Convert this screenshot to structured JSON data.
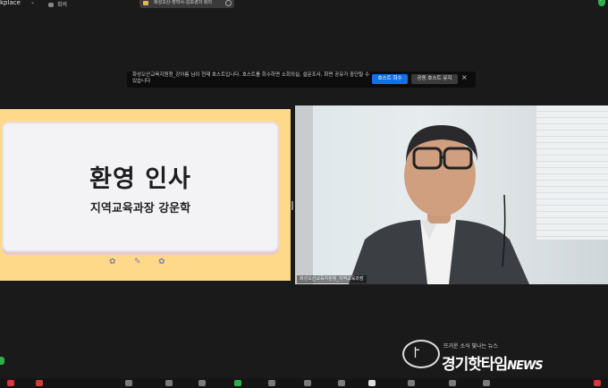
{
  "topbar": {
    "app_label": "kplace",
    "meeting_label": "회의",
    "meeting_title": "화성오산-장학사-김보경의 회의"
  },
  "banner": {
    "message": "화성오산교육지원청_강아름 님이 현재 호스트입니다. 호스트를 회수하면 소회의실, 설문조사, 화면 공유가 중단될 수 있습니다",
    "take_host_label": "호스트 회수",
    "keep_host_label": "공동 호스트 유지",
    "close_symbol": "×",
    "accent_color": "#0e72ed"
  },
  "slide": {
    "title": "환영 인사",
    "subtitle": "지역교육과장 강운학"
  },
  "video": {
    "participant_name": "화성오산교육지원청_지역교육과장"
  },
  "watermark": {
    "slogan": "뜨거운 소식 빛나는 뉴스",
    "name": "경기핫타임",
    "news": "NEWS"
  },
  "icons": {
    "security": "shield-check-icon",
    "lock": "lock-icon",
    "more": "more-icon"
  }
}
